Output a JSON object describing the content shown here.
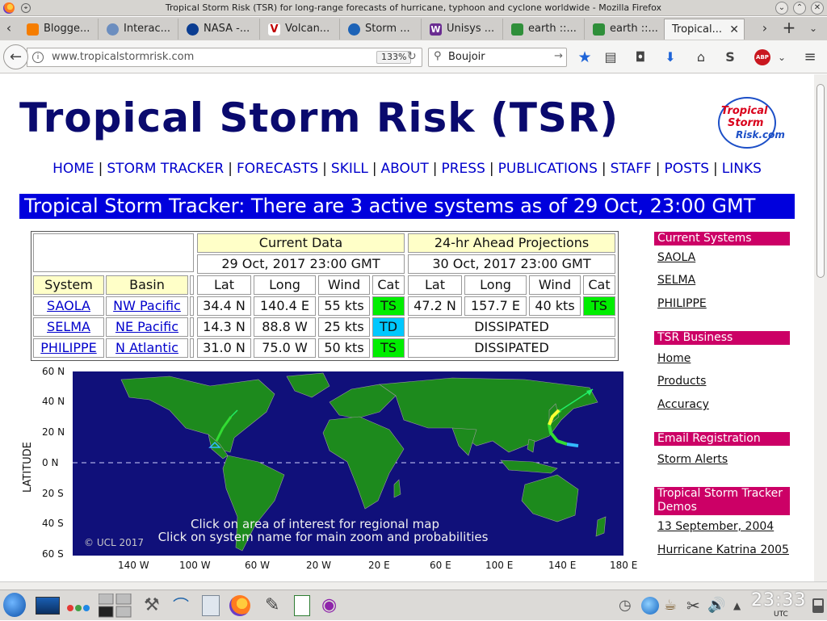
{
  "window": {
    "title": "Tropical Storm Risk (TSR) for long-range forecasts of hurricane, typhoon and cyclone worldwide - Mozilla Firefox"
  },
  "tabs": [
    {
      "label": "Blogge...",
      "color": "#f57d00"
    },
    {
      "label": "Interac...",
      "color": "#6c8ebf"
    },
    {
      "label": "NASA -...",
      "color": "#0b3d91"
    },
    {
      "label": "Volcan...",
      "color": "#c00000"
    },
    {
      "label": "Storm ...",
      "color": "#1d63b7"
    },
    {
      "label": "Unisys ...",
      "color": "#6a2c91"
    },
    {
      "label": "earth ::...",
      "color": "#2f8f3a"
    },
    {
      "label": "earth ::...",
      "color": "#2f8f3a"
    },
    {
      "label": "Tropical...",
      "color": "#cc0066"
    }
  ],
  "navbar": {
    "url": "www.tropicalstormrisk.com",
    "zoom": "133%",
    "search_value": "Boujoir"
  },
  "page": {
    "title": "Tropical Storm Risk (TSR)",
    "logo_lines": [
      "Tropical",
      "Storm",
      "Risk.com"
    ],
    "nav": [
      "HOME",
      "STORM TRACKER",
      "FORECASTS",
      "SKILL",
      "ABOUT",
      "PRESS",
      "PUBLICATIONS",
      "STAFF",
      "POSTS",
      "LINKS"
    ],
    "banner": "Tropical Storm Tracker: There are 3 active systems as of 29 Oct, 23:00 GMT"
  },
  "table": {
    "current_header": "Current Data",
    "projection_header": "24-hr Ahead Projections",
    "current_time": "29 Oct, 2017 23:00 GMT",
    "projection_time": "30 Oct, 2017 23:00 GMT",
    "col_system": "System",
    "col_basin": "Basin",
    "cols": [
      "Lat",
      "Long",
      "Wind",
      "Cat"
    ],
    "rows": [
      {
        "system": "SAOLA",
        "basin": "NW Pacific",
        "lat": "34.4 N",
        "long": "140.4 E",
        "wind": "55 kts",
        "cat": "TS",
        "p_lat": "47.2 N",
        "p_long": "157.7 E",
        "p_wind": "40 kts",
        "p_cat": "TS",
        "dissipated": ""
      },
      {
        "system": "SELMA",
        "basin": "NE Pacific",
        "lat": "14.3 N",
        "long": "88.8 W",
        "wind": "25 kts",
        "cat": "TD",
        "dissipated": "DISSIPATED"
      },
      {
        "system": "PHILIPPE",
        "basin": "N Atlantic",
        "lat": "31.0 N",
        "long": "75.0 W",
        "wind": "50 kts",
        "cat": "TS",
        "dissipated": "DISSIPATED"
      }
    ]
  },
  "map": {
    "lat_labels": [
      "60 N",
      "40 N",
      "20 N",
      "0 N",
      "20 S",
      "40 S",
      "60 S"
    ],
    "lon_labels": [
      "140 W",
      "100 W",
      "60 W",
      "20 W",
      "20 E",
      "60 E",
      "100 E",
      "140 E",
      "180 E"
    ],
    "lat_title": "LATITUDE",
    "instruction1": "Click on area of interest for regional map",
    "instruction2": "Click on system name for main zoom and probabilities",
    "copyright": "© UCL 2017"
  },
  "sidebar": {
    "current_systems_header": "Current Systems",
    "current_systems": [
      "SAOLA",
      "SELMA",
      "PHILIPPE"
    ],
    "business_header": "TSR Business",
    "business_links": [
      "Home",
      "Products",
      "Accuracy"
    ],
    "email_header": "Email Registration",
    "email_links": [
      "Storm Alerts"
    ],
    "demos_header": "Tropical Storm Tracker Demos",
    "demo_links": [
      "13 September, 2004",
      "Hurricane Katrina 2005"
    ]
  },
  "taskbar": {
    "clock": "23:33",
    "timezone": "UTC"
  },
  "colors": {
    "brand_navy": "#0a0a6e",
    "banner_blue": "#0000dd",
    "sidebar_magenta": "#cc0066",
    "link_blue": "#0000cc",
    "cat_ts": "#00ee00",
    "cat_td": "#00c8ff",
    "map_ocean": "#10107a",
    "map_land": "#1d8a1d"
  }
}
